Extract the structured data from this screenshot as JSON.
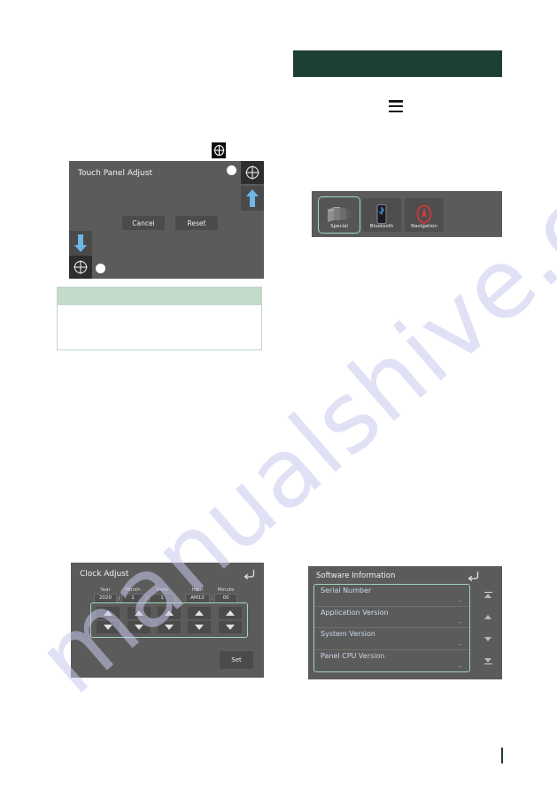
{
  "page": {
    "background_color": "#ffffff",
    "accent_green": "#1e4032",
    "note_header_color": "#c2dbca",
    "highlight_outline_color": "#9fd6bd"
  },
  "watermark": {
    "text": "manualshive.com",
    "color": "#c9c9ef"
  },
  "header_bar": {
    "label": "",
    "color": "#1e4032"
  },
  "menu_icon": {
    "name": "hamburger-menu-icon"
  },
  "crosshair_marker": {
    "name": "crosshair-target-icon"
  },
  "touch_panel_adjust": {
    "title": "Touch Panel Adjust",
    "buttons": {
      "cancel": "Cancel",
      "reset": "Reset"
    },
    "markers": {
      "top_right_crosshair": "crosshair-icon",
      "bottom_left_crosshair": "crosshair-icon",
      "up_arrow": "arrow-up-icon",
      "down_arrow": "arrow-down-icon",
      "top_right_dot": "touch-point-dot",
      "bottom_left_dot": "touch-point-dot"
    }
  },
  "note_box": {
    "header_text": "",
    "body_text": ""
  },
  "source_strip": {
    "tiles": [
      {
        "label": "Special",
        "icon": "special-stack-icon",
        "selected": true
      },
      {
        "label": "Bluetooth",
        "icon": "bluetooth-device-icon",
        "selected": false
      },
      {
        "label": "Navigation",
        "icon": "navigation-compass-icon",
        "selected": false
      }
    ]
  },
  "clock_adjust": {
    "title": "Clock Adjust",
    "back_icon": "back-arrow-icon",
    "fields": [
      {
        "label": "Year",
        "value": "2020",
        "separator": "/"
      },
      {
        "label": "Month",
        "value": "1",
        "separator": "/"
      },
      {
        "label": "Date",
        "value": "1",
        "separator": ""
      },
      {
        "label": "Hour",
        "value": "AM12",
        "separator": ":"
      },
      {
        "label": "Minute",
        "value": "00",
        "separator": ""
      }
    ],
    "stepper_up_icon": "triangle-up-icon",
    "stepper_down_icon": "triangle-down-icon",
    "set_button": "Set"
  },
  "software_information": {
    "title": "Software Information",
    "back_icon": "back-arrow-icon",
    "rows": [
      {
        "name": "Serial Number",
        "value": "-"
      },
      {
        "name": "Application Version",
        "value": "-"
      },
      {
        "name": "System Version",
        "value": "-"
      },
      {
        "name": "Panel CPU Version",
        "value": "-"
      }
    ],
    "scroll_buttons": [
      {
        "name": "scroll-to-top-button",
        "icon": "bar-up-icon"
      },
      {
        "name": "scroll-up-button",
        "icon": "triangle-up-icon"
      },
      {
        "name": "scroll-down-button",
        "icon": "triangle-down-icon"
      },
      {
        "name": "scroll-to-bottom-button",
        "icon": "bar-down-icon"
      }
    ]
  }
}
